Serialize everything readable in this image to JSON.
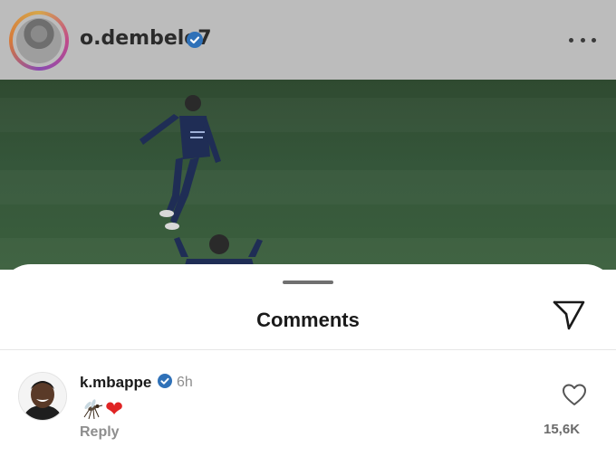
{
  "post": {
    "username": "o.dembele7",
    "verified": true
  },
  "sheet": {
    "title": "Comments"
  },
  "comments": [
    {
      "username": "k.mbappe",
      "verified": true,
      "time": "6h",
      "text_emojis": [
        "mosquito",
        "red-heart"
      ],
      "heart": "❤",
      "reply_label": "Reply",
      "like_count": "15,6K"
    }
  ],
  "colors": {
    "verified_badge": "#2f71b8",
    "heart": "#e02424",
    "secondary_text": "#8e8e8e"
  },
  "icons": [
    "more-options-icon",
    "verified-icon",
    "share-icon",
    "heart-outline-icon",
    "mosquito-icon"
  ]
}
